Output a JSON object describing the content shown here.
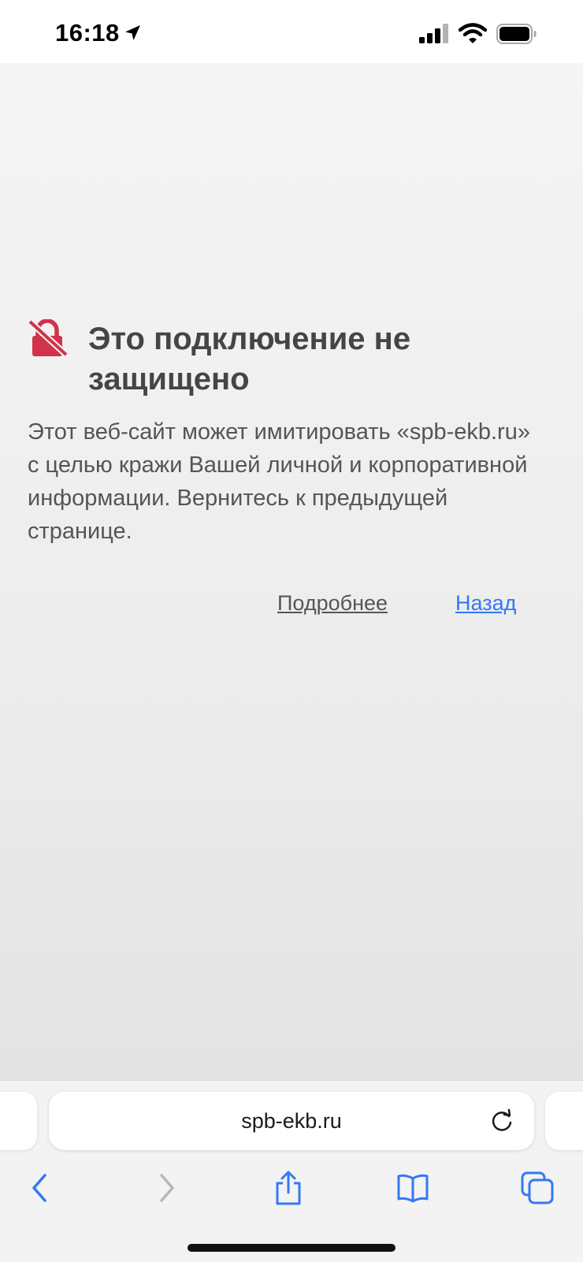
{
  "status_bar": {
    "time": "16:18"
  },
  "error_page": {
    "title": "Это подключение не защищено",
    "body": "Этот веб-сайт может имитировать «spb-ekb.ru» с целью кражи Вашей личной и корпоративной информации. Вернитесь к предыдущей странице.",
    "details_link": "Подробнее",
    "back_link": "Назад"
  },
  "address_bar": {
    "url": "spb-ekb.ru"
  },
  "toolbar": {
    "icons": [
      "back-icon",
      "forward-icon",
      "share-icon",
      "bookmarks-icon",
      "tabs-icon"
    ]
  },
  "colors": {
    "accent": "#3478f6",
    "warning": "#d0334a",
    "title": "#454545",
    "body_text": "#555555"
  },
  "icons": {
    "status": [
      "location-arrow-icon",
      "cellular-signal-icon",
      "wifi-icon",
      "battery-icon"
    ],
    "page": "insecure-lock-icon",
    "address": "reload-icon"
  }
}
